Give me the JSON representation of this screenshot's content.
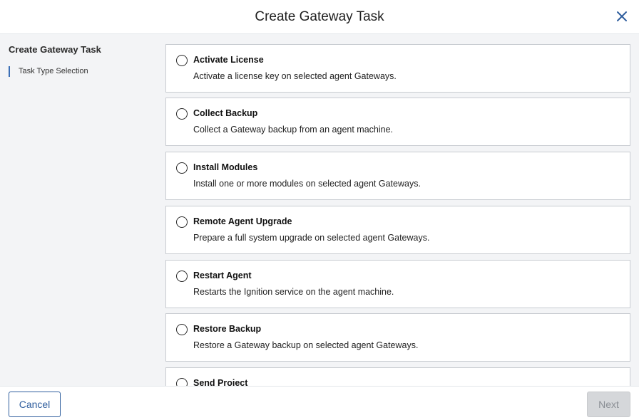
{
  "header": {
    "title": "Create Gateway Task",
    "close_icon": "close-icon"
  },
  "sidebar": {
    "title": "Create Gateway Task",
    "steps": [
      {
        "label": "Task Type Selection",
        "active": true
      }
    ]
  },
  "options": [
    {
      "title": "Activate License",
      "description": "Activate a license key on selected agent Gateways.",
      "selected": false
    },
    {
      "title": "Collect Backup",
      "description": "Collect a Gateway backup from an agent machine.",
      "selected": false
    },
    {
      "title": "Install Modules",
      "description": "Install one or more modules on selected agent Gateways.",
      "selected": false
    },
    {
      "title": "Remote Agent Upgrade",
      "description": "Prepare a full system upgrade on selected agent Gateways.",
      "selected": false
    },
    {
      "title": "Restart Agent",
      "description": "Restarts the Ignition service on the agent machine.",
      "selected": false
    },
    {
      "title": "Restore Backup",
      "description": "Restore a Gateway backup on selected agent Gateways.",
      "selected": false
    },
    {
      "title": "Send Project",
      "selected": false
    }
  ],
  "footer": {
    "cancel_label": "Cancel",
    "next_label": "Next",
    "next_disabled": true
  },
  "colors": {
    "accent": "#2f5e9e",
    "step_indicator": "#3b6fb6",
    "panel_bg": "#f3f4f6",
    "disabled_bg": "#d5d7da"
  }
}
